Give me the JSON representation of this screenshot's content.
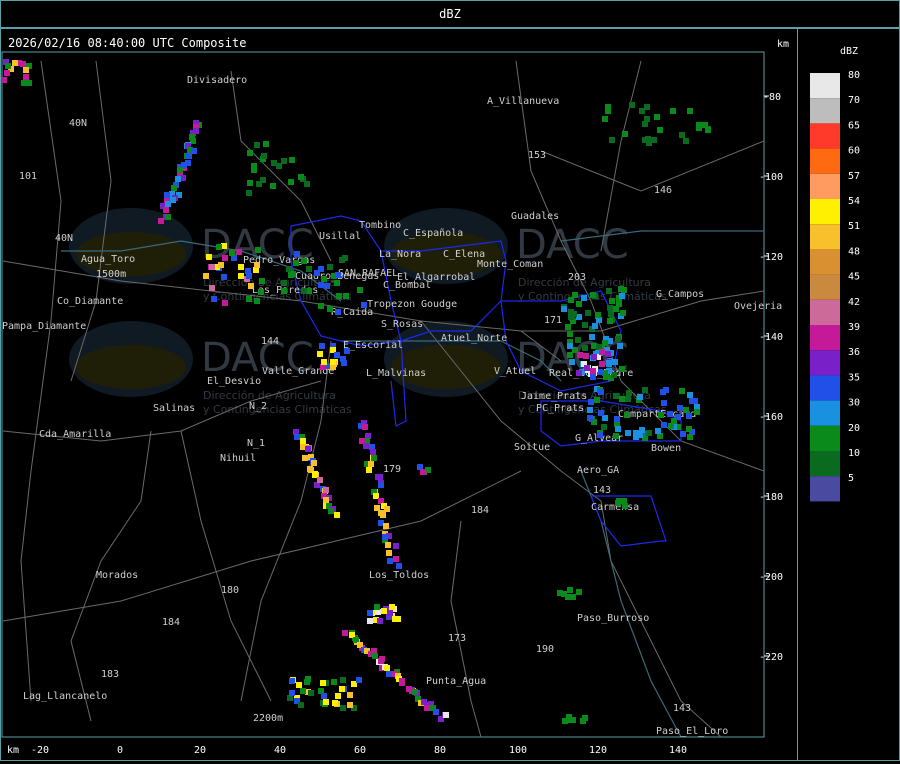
{
  "window": {
    "title": "dBZ"
  },
  "map": {
    "header": "2026/02/16 08:40:00 UTC Composite",
    "unit_label": "km",
    "x_ticks": [
      "-20",
      "0",
      "20",
      "40",
      "60",
      "80",
      "100",
      "120",
      "140"
    ],
    "y_ticks": [
      "-80",
      "-100",
      "-120",
      "-140",
      "-160",
      "-180",
      "-200",
      "-220"
    ],
    "bottom_unit": "km",
    "watermark": {
      "logo": "DACC",
      "line1": "Dirección de Agricultura",
      "line2": "y Contingencias Climáticas"
    },
    "places": [
      "Divisadero",
      "A_Villanueva",
      "Guadales",
      "G_Campos",
      "Ovejeria",
      "Agua_Toro",
      "1500m",
      "Pampa_Diamante",
      "Co_Diamante",
      "Usillal",
      "Tombino",
      "C_Española",
      "La_Nora",
      "C_Elena",
      "Monte_Coman",
      "Cuadro_Benegas",
      "SAN_RAFAEL",
      "El_Algarrobal",
      "C_Bombal",
      "Pedro_Vargas",
      "Las_Paredes",
      "R_Caida",
      "Tropezon",
      "Goudge",
      "S_Rosas",
      "Atuel_Norte",
      "E_Escorial",
      "Real_del_Padre",
      "El_Desvio",
      "Valle_Grande",
      "L_Malvinas",
      "V_Atuel",
      "Jaime_Prats",
      "PC_Prats",
      "CompartEscard",
      "Salinas",
      "Cda_Amarilla",
      "Nihuil",
      "N_1",
      "N_2",
      "Soitue",
      "G_Alvear",
      "Bowen",
      "Aero_GA",
      "Carmensa",
      "Los_Toldos",
      "Morados",
      "Paso_Burroso",
      "Punta_Agua",
      "Lag_Llancanelo",
      "2200m",
      "Paso_El_Loro"
    ],
    "route_numbers": [
      "153",
      "146",
      "171",
      "101",
      "144",
      "143",
      "179",
      "184",
      "180",
      "184",
      "183",
      "190",
      "173",
      "40N",
      "40N",
      "203",
      "143"
    ]
  },
  "legend": {
    "title": "dBZ",
    "levels": [
      {
        "label": "80",
        "color": "#e8e8e8"
      },
      {
        "label": "70",
        "color": "#bdbdbd"
      },
      {
        "label": "65",
        "color": "#ff3a2a"
      },
      {
        "label": "60",
        "color": "#ff6a10"
      },
      {
        "label": "57",
        "color": "#ff9a60"
      },
      {
        "label": "54",
        "color": "#ffef00"
      },
      {
        "label": "51",
        "color": "#f8c02a"
      },
      {
        "label": "48",
        "color": "#d89030"
      },
      {
        "label": "45",
        "color": "#c98a40"
      },
      {
        "label": "42",
        "color": "#cc6a9a"
      },
      {
        "label": "39",
        "color": "#c41a9a"
      },
      {
        "label": "36",
        "color": "#7a20c8"
      },
      {
        "label": "35",
        "color": "#2050e8"
      },
      {
        "label": "30",
        "color": "#1a90e0"
      },
      {
        "label": "20",
        "color": "#0a8a1a"
      },
      {
        "label": "10",
        "color": "#0a6a20"
      },
      {
        "label": "5",
        "color": "#4a4aa0"
      }
    ]
  }
}
